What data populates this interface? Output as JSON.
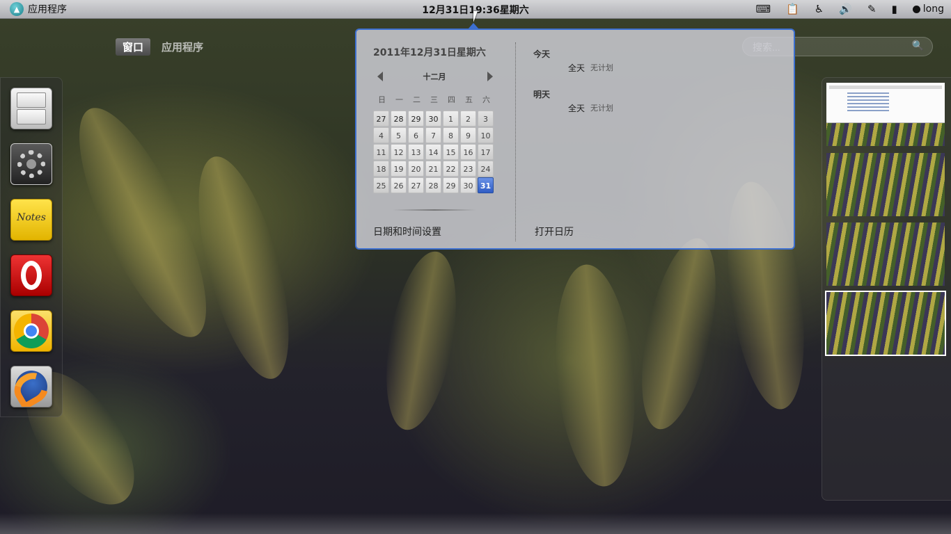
{
  "topbar": {
    "activities_label": "应用程序",
    "clock": "12月31日19:36星期六",
    "user": "long",
    "tray_icons": [
      "keyboard-icon",
      "clipboard-icon",
      "accessibility-icon",
      "volume-icon",
      "pen-icon",
      "battery-icon"
    ]
  },
  "overview": {
    "tabs": [
      {
        "label": "窗口",
        "active": true
      },
      {
        "label": "应用程序",
        "active": false
      }
    ],
    "search_placeholder": "搜索..."
  },
  "dash": {
    "apps": [
      "file-manager",
      "system-settings",
      "notes",
      "opera",
      "chrome",
      "firefox"
    ],
    "notes_icon_text": "Notes"
  },
  "calendar": {
    "date_heading": "2011年12月31日星期六",
    "month": "十二月",
    "weekdays": [
      "日",
      "一",
      "二",
      "三",
      "四",
      "五",
      "六"
    ],
    "weeks": [
      [
        "27",
        "28",
        "29",
        "30",
        "1",
        "2",
        "3"
      ],
      [
        "4",
        "5",
        "6",
        "7",
        "8",
        "9",
        "10"
      ],
      [
        "11",
        "12",
        "13",
        "14",
        "15",
        "16",
        "17"
      ],
      [
        "18",
        "19",
        "20",
        "21",
        "22",
        "23",
        "24"
      ],
      [
        "25",
        "26",
        "27",
        "28",
        "29",
        "30",
        "31"
      ]
    ],
    "selected_day": "31",
    "settings_link": "日期和时间设置",
    "open_calendar": "打开日历"
  },
  "events": {
    "today_label": "今天",
    "today_time": "全天",
    "today_desc": "无计划",
    "tomorrow_label": "明天",
    "tomorrow_time": "全天",
    "tomorrow_desc": "无计划"
  },
  "colors": {
    "accent": "#3c6fd0",
    "today_highlight": "#2f5cc4"
  }
}
